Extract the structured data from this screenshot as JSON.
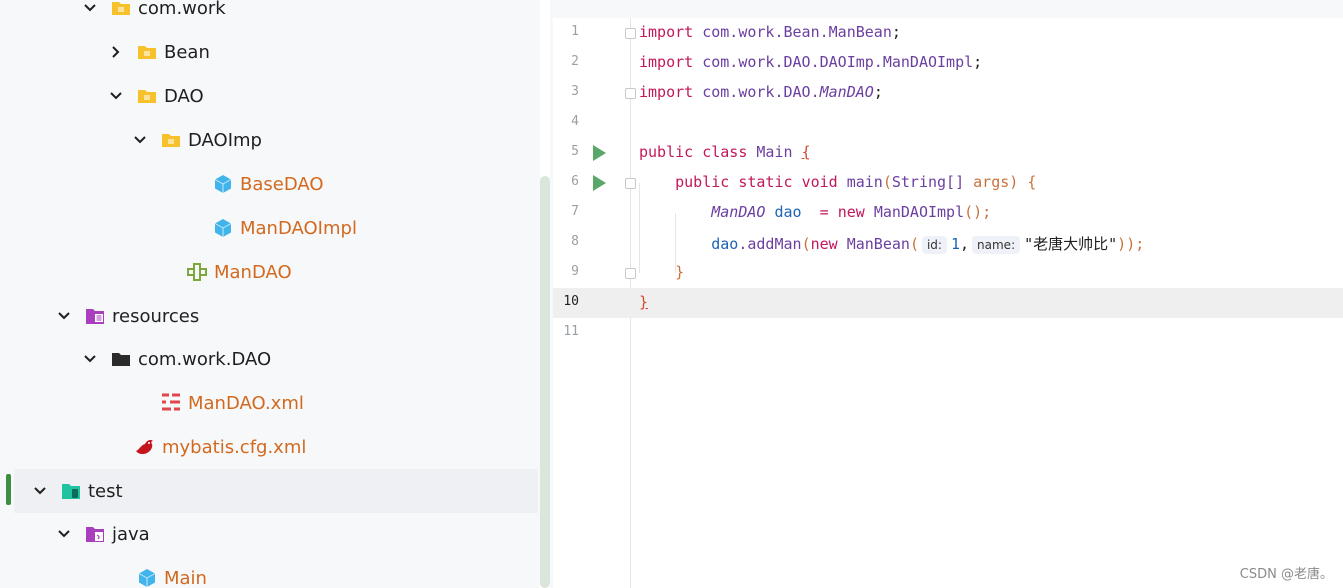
{
  "tree": {
    "items": [
      {
        "label": "com.work",
        "chevron": "open",
        "icon": "package-folder-icon",
        "orange": false
      },
      {
        "label": "Bean",
        "chevron": "closed",
        "icon": "package-folder-icon",
        "orange": false
      },
      {
        "label": "DAO",
        "chevron": "open",
        "icon": "package-folder-icon",
        "orange": false
      },
      {
        "label": "DAOImp",
        "chevron": "open",
        "icon": "package-folder-icon",
        "orange": false
      },
      {
        "label": "BaseDAO",
        "chevron": "none",
        "icon": "class-icon",
        "orange": true
      },
      {
        "label": "ManDAOImpl",
        "chevron": "none",
        "icon": "class-icon",
        "orange": true
      },
      {
        "label": "ManDAO",
        "chevron": "none",
        "icon": "interface-icon",
        "orange": true
      },
      {
        "label": "resources",
        "chevron": "open",
        "icon": "resources-folder-icon",
        "orange": false
      },
      {
        "label": "com.work.DAO",
        "chevron": "open",
        "icon": "dark-folder-icon",
        "orange": false
      },
      {
        "label": "ManDAO.xml",
        "chevron": "none",
        "icon": "xml-file-icon",
        "orange": true
      },
      {
        "label": "mybatis.cfg.xml",
        "chevron": "none",
        "icon": "mybatis-bird-icon",
        "orange": true
      },
      {
        "label": "test",
        "chevron": "open",
        "icon": "test-folder-icon",
        "orange": false
      },
      {
        "label": "java",
        "chevron": "open",
        "icon": "java-source-folder-icon",
        "orange": false
      },
      {
        "label": "Main",
        "chevron": "none",
        "icon": "class-icon",
        "orange": true
      }
    ]
  },
  "editor": {
    "current_line": 10,
    "lines": [
      {
        "n": "1"
      },
      {
        "n": "2"
      },
      {
        "n": "3"
      },
      {
        "n": "4"
      },
      {
        "n": "5"
      },
      {
        "n": "6"
      },
      {
        "n": "7"
      },
      {
        "n": "8"
      },
      {
        "n": "9"
      },
      {
        "n": "10"
      },
      {
        "n": "11"
      }
    ],
    "tokens": {
      "import": "import",
      "l1_path": "com.work.Bean.ManBean",
      "l2_path": "com.work.DAO.DAOImp.ManDAOImpl",
      "l3_pkg": "com.work.DAO.",
      "l3_itf": "ManDAO",
      "semi": ";",
      "public": "public",
      "class": "class",
      "main_class": "Main",
      "open_brace": "{",
      "close_brace": "}",
      "static": "static",
      "void": "void",
      "main": "main",
      "string_args": "String[]",
      "args": "args",
      "lparen": "(",
      "rparen": ")",
      "l7_type": "ManDAO",
      "l7_var": "dao",
      "l7_eq": " = ",
      "new": "new",
      "l7_ctor": "ManDAOImpl",
      "l7_call": "();",
      "l8_var": "dao",
      "l8_meth": ".addMan",
      "l8_ctor": "ManBean",
      "hint_id": "id:",
      "arg_id": "1",
      "comma": ",",
      "hint_name": "name:",
      "arg_name": "\"老唐大帅比\"",
      "l8_end": "));"
    }
  },
  "watermark": "CSDN @老唐。"
}
